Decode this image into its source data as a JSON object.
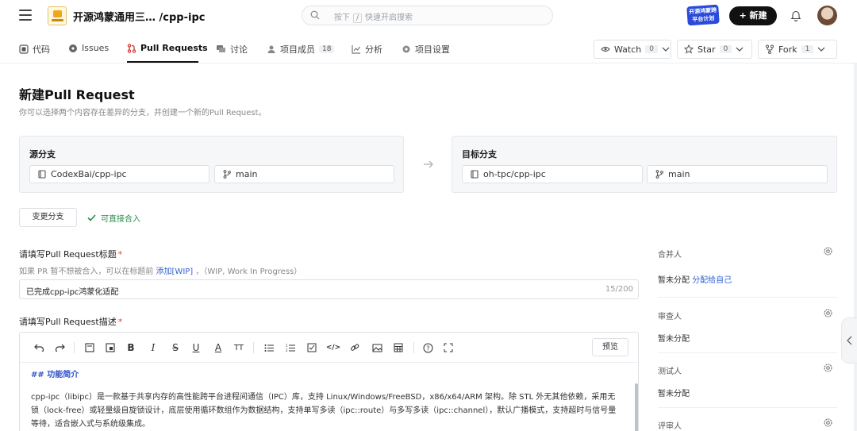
{
  "topbar": {
    "repo_title": "开源鸿蒙通用三… /cpp-ipc",
    "search_prefix": "按下",
    "search_key": "/",
    "search_suffix": "快速开启搜索",
    "badge_text": "开源鸿蒙跨平台计划",
    "new_button": "+ 新建"
  },
  "tabs": [
    {
      "label": "代码"
    },
    {
      "label": "Issues"
    },
    {
      "label": "Pull Requests"
    },
    {
      "label": "讨论"
    },
    {
      "label": "项目成员",
      "count": "18"
    },
    {
      "label": "分析"
    },
    {
      "label": "项目设置"
    }
  ],
  "repo_actions": {
    "watch": {
      "label": "Watch",
      "count": "0"
    },
    "star": {
      "label": "Star",
      "count": "0"
    },
    "fork": {
      "label": "Fork",
      "count": "1"
    }
  },
  "page": {
    "title": "新建Pull Request",
    "subtitle": "你可以选择两个内容存在差异的分支，并创建一个新的Pull Request。"
  },
  "source": {
    "label": "源分支",
    "repo": "CodexBai/cpp-ipc",
    "branch": "main"
  },
  "target": {
    "label": "目标分支",
    "repo": "oh-tpc/cpp-ipc",
    "branch": "main"
  },
  "actions": {
    "change_branch": "变更分支",
    "mergeable": "可直接合入"
  },
  "form": {
    "title_label": "请填写Pull Request标题",
    "required_mark": "*",
    "hint_prefix": "如果 PR 暂不想被合入，可以在标题前",
    "hint_link": "添加[WIP]",
    "hint_suffix": "，（WIP, Work In Progress）",
    "title_value": "已完成cpp-ipc鸿蒙化适配",
    "title_count": "15/200",
    "desc_label": "请填写Pull Request描述",
    "preview_button": "预览",
    "desc_heading": "## 功能简介",
    "desc_body": "cpp-ipc（libipc）是一款基于共享内存的高性能跨平台进程间通信（IPC）库，支持 Linux/Windows/FreeBSD，x86/x64/ARM 架构。除 STL 外无其他依赖，采用无锁（lock-free）或轻量级自旋锁设计，底层使用循环数组作为数据结构，支持单写多读（ipc::route）与多写多读（ipc::channel），默认广播模式，支持超时与信号量等待，适合嵌入式与系统级集成。"
  },
  "sidebar": {
    "merger": {
      "label": "合并人",
      "value": "暂未分配",
      "link": "分配给自己"
    },
    "reviewer": {
      "label": "审查人",
      "value": "暂未分配"
    },
    "tester": {
      "label": "测试人",
      "value": "暂未分配"
    },
    "approver": {
      "label": "评审人"
    }
  }
}
